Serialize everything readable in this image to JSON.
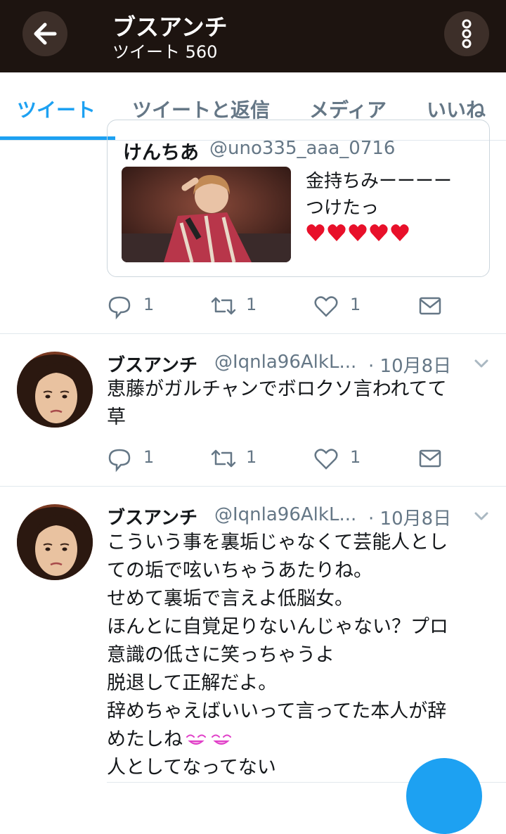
{
  "header": {
    "title": "ブスアンチ",
    "subtitle": "ツイート 560"
  },
  "tabs": [
    {
      "label": "ツイート",
      "active": true
    },
    {
      "label": "ツイートと返信",
      "active": false
    },
    {
      "label": "メディア",
      "active": false
    },
    {
      "label": "いいね",
      "active": false
    }
  ],
  "quoted_tweet": {
    "name": "けんちあ",
    "handle": "@uno335_aaa_0716",
    "text": "金持ちみーーーー\nつけたっ",
    "emoji": "heart-emoji x5"
  },
  "tweet0_actions": {
    "reply": "1",
    "retweet": "1",
    "like": "1"
  },
  "tweets": [
    {
      "name": "ブスアンチ",
      "handle": "@Iqnla96AlkL...",
      "date": "· 10月8日",
      "lines": [
        "恵藤がガルチャンでボロクソ言われてて",
        "草"
      ],
      "reply": "1",
      "retweet": "1",
      "like": "1"
    },
    {
      "name": "ブスアンチ",
      "handle": "@Iqnla96AlkL...",
      "date": "· 10月8日",
      "lines": [
        "こういう事を裏垢じゃなくて芸能人とし",
        "ての垢で呟いちゃうあたりね。",
        "せめて裏垢で言えよ低脳女。",
        "ほんとに自覚足りないんじゃない？プロ",
        "意識の低さに笑っちゃうよ",
        "脱退して正解だよ。",
        "辞めちゃえばいいって言ってた本人が辞",
        "めたしね",
        "人としてなってない"
      ]
    }
  ],
  "colors": {
    "header_bg": "#1d1410",
    "accent": "#1da1f2",
    "muted": "#657786"
  }
}
